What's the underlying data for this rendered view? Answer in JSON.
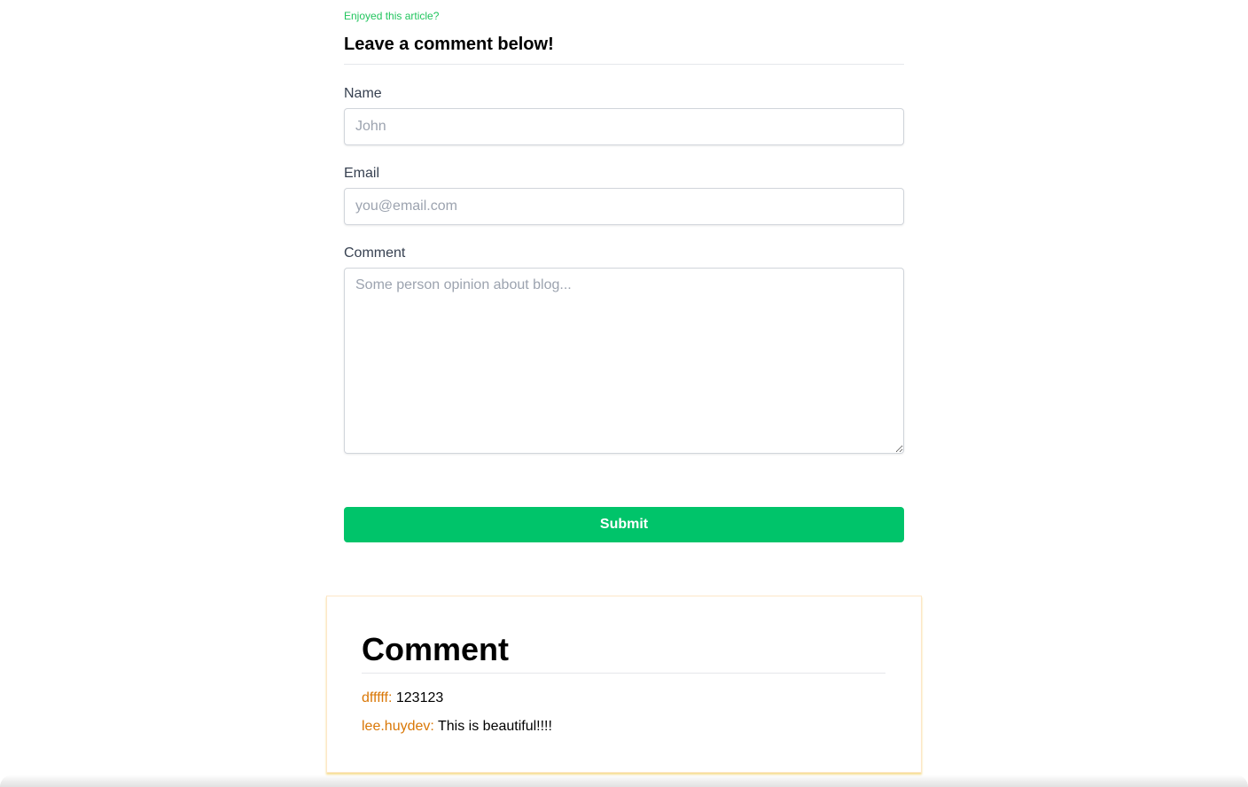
{
  "form": {
    "eyebrow": "Enjoyed this article?",
    "title": "Leave a comment below!",
    "name_label": "Name",
    "name_placeholder": "John",
    "email_label": "Email",
    "email_placeholder": "you@email.com",
    "comment_label": "Comment",
    "comment_placeholder": "Some person opinion about blog...",
    "submit_label": "Submit"
  },
  "comments": {
    "title": "Comment",
    "items": [
      {
        "author": "dfffff:",
        "text": "123123"
      },
      {
        "author": "lee.huydev:",
        "text": "This is beautiful!!!!"
      }
    ]
  },
  "colors": {
    "accent_green": "#00c46a",
    "eyebrow_green": "#22c55e",
    "author_orange": "#d97706"
  }
}
